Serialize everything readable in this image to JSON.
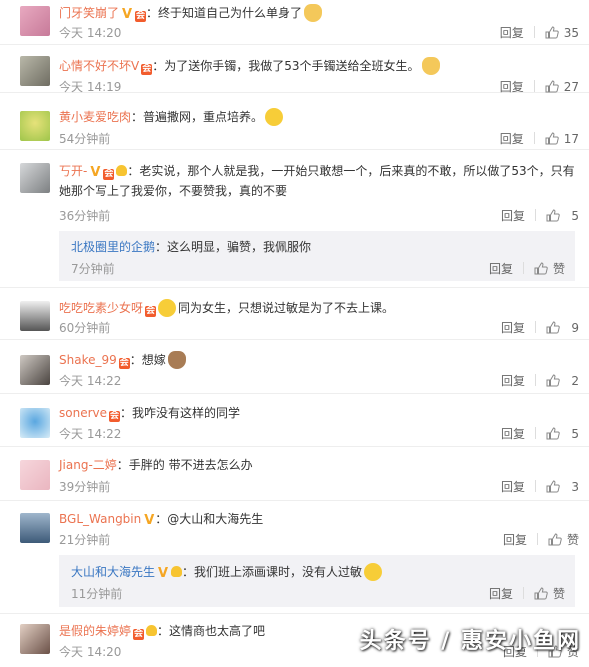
{
  "comments": [
    {
      "name": "门牙笑崩了",
      "text": "：终于知道自己为什么单身了",
      "time": "今天 14:20",
      "reply": "回复",
      "likes": "35"
    },
    {
      "name": "心情不好不坏V",
      "text": "：为了送你手镯，我做了53个手镯送给全班女生。",
      "time": "今天 14:19",
      "reply": "回复",
      "likes": "27"
    },
    {
      "name": "黄小麦爱吃肉",
      "text": "：普遍撒网，重点培养。",
      "time": "54分钟前",
      "reply": "回复",
      "likes": "17"
    },
    {
      "name": "丂开-",
      "text": "：老实说，那个人就是我，一开始只敢想一个，后来真的不敢，所以做了53个，只有她那个写上了我爱你，不要赞我，真的不要",
      "time": "36分钟前",
      "reply": "回复",
      "likes": "5"
    },
    {
      "name": "北极圈里的企鹅",
      "text": "：这么明显，骗赞，我佩服你",
      "time": "7分钟前",
      "reply": "回复",
      "likes": "赞"
    },
    {
      "name": "吃吃吃素少女呀",
      "text": "同为女生，只想说过敏是为了不去上课。",
      "time": "60分钟前",
      "reply": "回复",
      "likes": "9"
    },
    {
      "name": "Shake_99",
      "text": "：想嫁",
      "time": "今天 14:22",
      "reply": "回复",
      "likes": "2"
    },
    {
      "name": "sonerve",
      "text": "：我咋没有这样的同学",
      "time": "今天 14:22",
      "reply": "回复",
      "likes": "5"
    },
    {
      "name": "Jiang-二婷",
      "text": "：手胖的 带不进去怎么办",
      "time": "39分钟前",
      "reply": "回复",
      "likes": "3"
    },
    {
      "name": "BGL_Wangbin",
      "text": "：@大山和大海先生",
      "time": "21分钟前",
      "reply": "回复",
      "likes": "赞"
    },
    {
      "name": "大山和大海先生",
      "text": "：我们班上添画课时，没有人过敏",
      "time": "11分钟前",
      "reply": "回复",
      "likes": "赞"
    },
    {
      "name": "是假的朱婷婷",
      "text": "：这情商也太高了吧",
      "time": "今天 14:20",
      "reply": "回复",
      "likes": "赞"
    }
  ],
  "watermark": "头条号 / 惠安小鱼网",
  "colors": {
    "name": "#eb7350",
    "sub_name": "#3a77c2",
    "time": "#999999",
    "sub_bg": "#f2f2f5"
  }
}
